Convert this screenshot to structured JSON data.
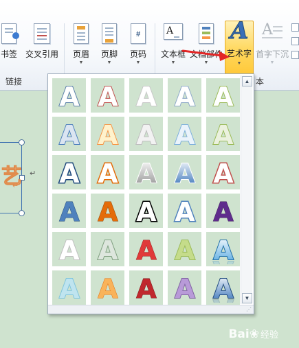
{
  "ribbon": {
    "buttons": [
      {
        "label": "书签",
        "icon": "bookmark-icon"
      },
      {
        "label": "交叉引用",
        "icon": "cross-reference-icon"
      },
      {
        "label": "页眉",
        "icon": "header-icon"
      },
      {
        "label": "页脚",
        "icon": "footer-icon"
      },
      {
        "label": "页码",
        "icon": "page-number-icon"
      },
      {
        "label": "文本框",
        "icon": "text-box-icon"
      },
      {
        "label": "文档部件",
        "icon": "quick-parts-icon"
      },
      {
        "label": "艺术字",
        "icon": "wordart-icon"
      },
      {
        "label": "首字下沉",
        "icon": "drop-cap-icon"
      }
    ],
    "groups": {
      "links": "链接",
      "text_partial": "本"
    },
    "page_number_glyph": "#",
    "text_box_glyph": "A",
    "wordart_glyph": "A",
    "dropdown_arrow": "▼"
  },
  "gallery": {
    "glyph": "A",
    "scroll_up": "▲",
    "scroll_down": "▼",
    "grip": "⋰",
    "styles": [
      {
        "fill": "#ffffff",
        "stroke": "#5a7fa8",
        "effect": "outline"
      },
      {
        "fill": "#ffffff",
        "stroke": "#c0504d",
        "effect": "outline"
      },
      {
        "fill": "#ffffff",
        "stroke": "#c8c8c8",
        "effect": "outline"
      },
      {
        "fill": "#ffffff",
        "stroke": "#8ea9c8",
        "effect": "outline"
      },
      {
        "fill": "#ffffff",
        "stroke": "#9bbb59",
        "effect": "outline"
      },
      {
        "fill": "#dbe5f1",
        "stroke": "#4f81bd",
        "effect": "soft"
      },
      {
        "fill": "#fff2cc",
        "stroke": "#f79646",
        "effect": "soft"
      },
      {
        "fill": "#f2f2f2",
        "stroke": "#bfbfbf",
        "effect": "soft"
      },
      {
        "fill": "#eaf3fb",
        "stroke": "#7fb1dc",
        "effect": "soft"
      },
      {
        "fill": "#ebf1de",
        "stroke": "#9bbb59",
        "effect": "soft"
      },
      {
        "fill": "#ffffff",
        "stroke": "#1f497d",
        "effect": "bold"
      },
      {
        "fill": "#ffffff",
        "stroke": "#e46c0a",
        "effect": "bold"
      },
      {
        "fill": "#8c8c8c",
        "stroke": "#ffffff",
        "effect": "metal"
      },
      {
        "fill": "#2e6cb5",
        "stroke": "#ffffff",
        "effect": "metal"
      },
      {
        "fill": "#ffffff",
        "stroke": "#c0504d",
        "effect": "bold"
      },
      {
        "fill": "#4f81bd",
        "stroke": "#1f497d",
        "effect": "solid"
      },
      {
        "fill": "#e46c0a",
        "stroke": "#974806",
        "effect": "solid"
      },
      {
        "fill": "#ffffff",
        "stroke": "#000000",
        "effect": "bold"
      },
      {
        "fill": "#ffffff",
        "stroke": "#4f81bd",
        "effect": "bold"
      },
      {
        "fill": "#5f2c8c",
        "stroke": "#3f1d5e",
        "effect": "solid"
      },
      {
        "fill": "#ffffff",
        "stroke": "#bfbfbf",
        "effect": "soft"
      },
      {
        "fill": "#dde6dd",
        "stroke": "#7f9f7f",
        "effect": "soft"
      },
      {
        "fill": "#e03a3a",
        "stroke": "#9c1c1c",
        "effect": "solid"
      },
      {
        "fill": "#c5dc8a",
        "stroke": "#9bbb59",
        "effect": "soft"
      },
      {
        "fill": "#4aa3df",
        "stroke": "#1f6fa8",
        "effect": "reflect"
      },
      {
        "fill": "#bfe4ef",
        "stroke": "#7fc4dc",
        "effect": "soft"
      },
      {
        "fill": "#f9b35a",
        "stroke": "#e46c0a",
        "effect": "solid"
      },
      {
        "fill": "#c0282d",
        "stroke": "#7a1518",
        "effect": "solid"
      },
      {
        "fill": "#b89ad8",
        "stroke": "#8064a2",
        "effect": "soft"
      },
      {
        "fill": "#2e6cb5",
        "stroke": "#1f497d",
        "effect": "reflect"
      }
    ]
  },
  "document": {
    "art_fragment": "艺",
    "para_mark_1": "↵",
    "para_mark_2": "↵"
  },
  "watermark": {
    "brand": "Bai",
    "paw": "❀",
    "text": "经验"
  },
  "colors": {
    "active_button": "#ffd85e",
    "callout_arrow": "#e32626",
    "canvas": "#cfe3cf"
  }
}
